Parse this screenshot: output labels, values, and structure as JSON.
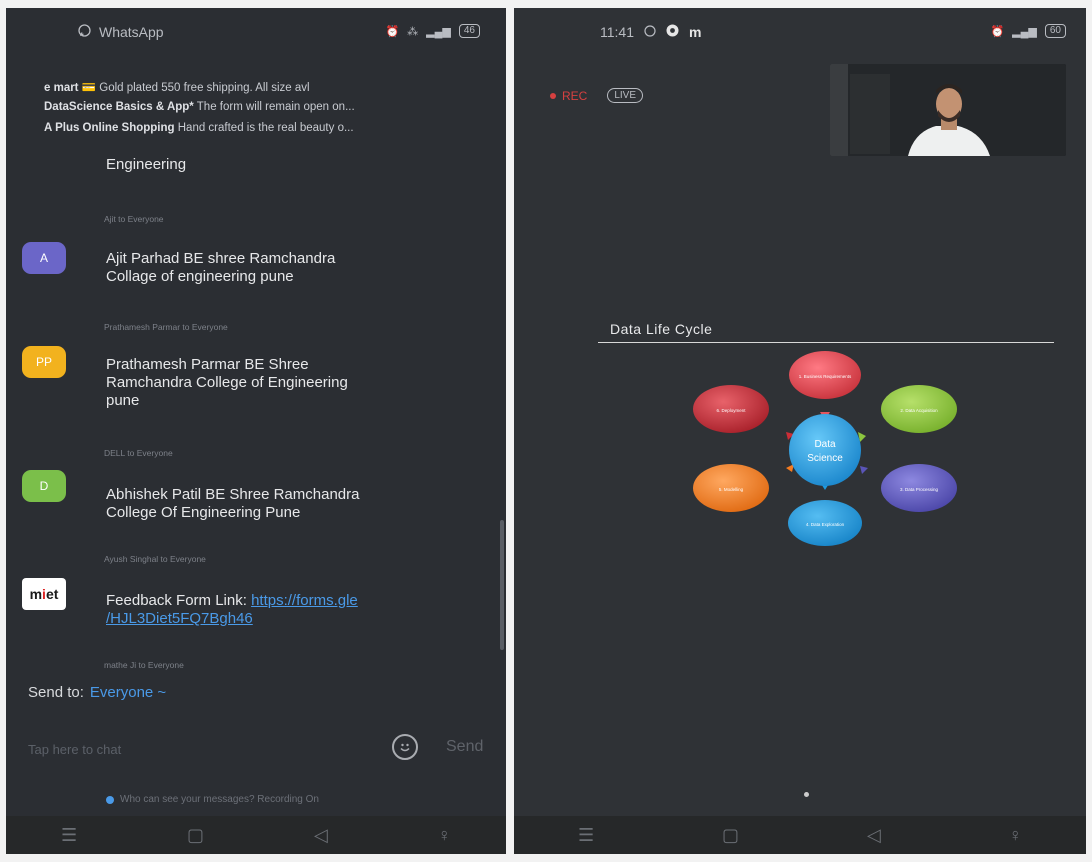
{
  "left": {
    "status": {
      "app": "WhatsApp",
      "icons": [
        "alarm-icon",
        "volte-icon",
        "signal-icon",
        "signal-icon",
        "battery-icon"
      ],
      "indicators": [
        "𝌗",
        "⁂",
        "ᵥₒ",
        "4G"
      ],
      "battery": "46"
    },
    "notifications": [
      {
        "source": "e mart",
        "text": "💳 Gold plated 550 free shipping. All size avl"
      },
      {
        "source": "DataScience Basics & App*",
        "text": "The form will remain open on..."
      },
      {
        "source": "A Plus Online Shopping",
        "text": "Hand crafted is the real beauty o..."
      }
    ],
    "chat": {
      "messages": [
        {
          "sender": "",
          "body": "Engineering"
        },
        {
          "sender": "Ajit to Everyone",
          "avatar": "A",
          "avatar_color": "#6b66c8",
          "body_lines": [
            "Ajit Parhad  BE shree Ramchandra",
            "Collage of engineering pune"
          ]
        },
        {
          "sender": "Prathamesh Parmar to Everyone",
          "avatar": "PP",
          "avatar_color": "#f2b21e",
          "body_lines": [
            "Prathamesh Parmar BE Shree",
            "Ramchandra College of Engineering",
            "pune"
          ]
        },
        {
          "sender": "DELL to Everyone",
          "avatar": "D",
          "avatar_color": "#7bbf4a",
          "body_lines": [
            "Abhishek Patil BE Shree Ramchandra",
            "College Of Engineering Pune"
          ]
        },
        {
          "sender": "Ayush Singhal to Everyone",
          "avatar": "miet",
          "body_prefix": "Feedback Form Link: ",
          "link_lines": [
            "https://forms.gle",
            "/HJL3Diet5FQ7Bgh46"
          ]
        },
        {
          "sender": "mathe Ji to Everyone"
        }
      ]
    },
    "send_to": {
      "label": "Send to:",
      "value": "Everyone ~"
    },
    "input": {
      "placeholder": "Tap here to chat",
      "send": "Send"
    },
    "privacy": "Who can see your messages? Recording On",
    "navbar": [
      "menu-icon",
      "home-icon",
      "back-icon",
      "accessibility-icon"
    ]
  },
  "right": {
    "status": {
      "time": "11:41",
      "battery": "60"
    },
    "rec": "REC",
    "live": "LIVE",
    "slide": {
      "title": "Data Life Cycle",
      "center": [
        "Data",
        "Science"
      ],
      "nodes": [
        {
          "label": "1. Business Requirements",
          "color": "#e0434f"
        },
        {
          "label": "2. Data Acquisition",
          "color": "#8cc63f"
        },
        {
          "label": "3. Data Processing",
          "color": "#5a55b8"
        },
        {
          "label": "4. Data Exploration",
          "color": "#1e9be0"
        },
        {
          "label": "5. Modelling",
          "color": "#f47b20"
        },
        {
          "label": "6. Deployment",
          "color": "#cc2d37"
        }
      ]
    }
  }
}
